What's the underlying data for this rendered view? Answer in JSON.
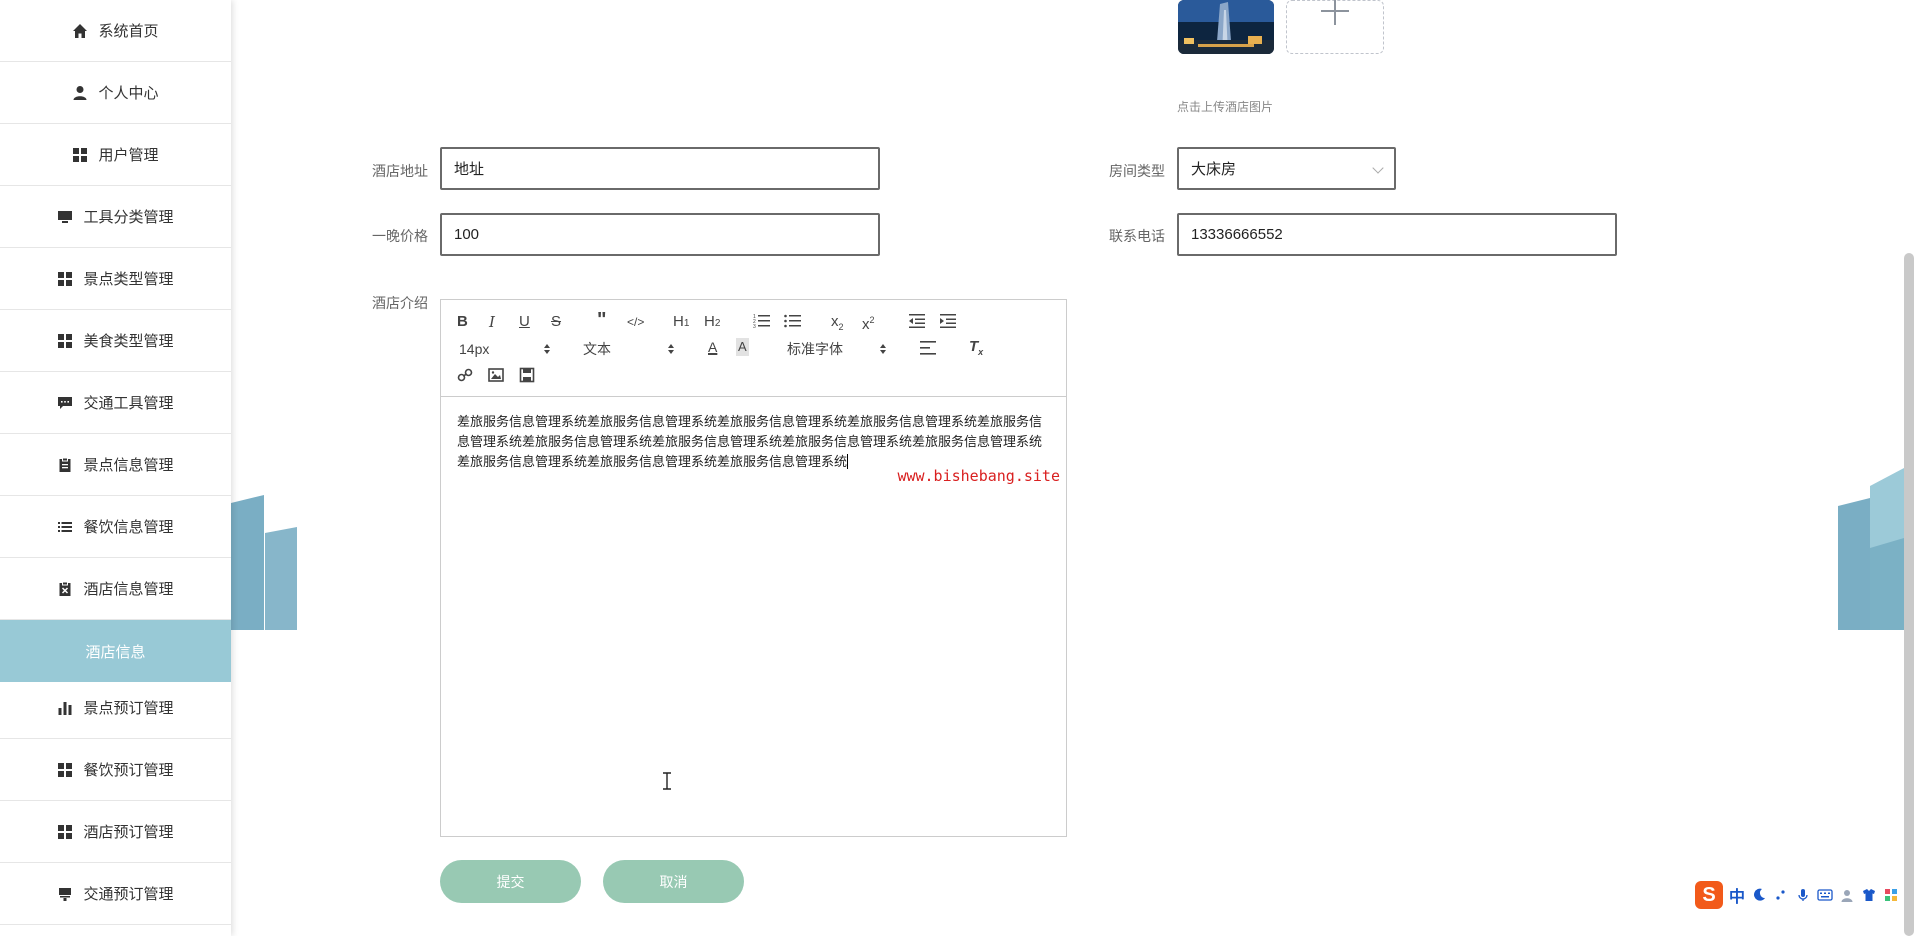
{
  "sidebar": {
    "items": [
      {
        "label": "系统首页",
        "icon": "home-icon"
      },
      {
        "label": "个人中心",
        "icon": "user-icon"
      },
      {
        "label": "用户管理",
        "icon": "grid-icon"
      },
      {
        "label": "工具分类管理",
        "icon": "monitor-icon"
      },
      {
        "label": "景点类型管理",
        "icon": "grid-icon"
      },
      {
        "label": "美食类型管理",
        "icon": "grid-icon"
      },
      {
        "label": "交通工具管理",
        "icon": "chat-icon"
      },
      {
        "label": "景点信息管理",
        "icon": "clipboard-icon"
      },
      {
        "label": "餐饮信息管理",
        "icon": "list-icon"
      },
      {
        "label": "酒店信息管理",
        "icon": "clipboard-x-icon"
      },
      {
        "label": "酒店信息",
        "icon": "",
        "active": true
      },
      {
        "label": "景点预订管理",
        "icon": "bar-chart-icon"
      },
      {
        "label": "餐饮预订管理",
        "icon": "grid-icon"
      },
      {
        "label": "酒店预订管理",
        "icon": "grid-icon"
      },
      {
        "label": "交通预订管理",
        "icon": "stamp-icon"
      }
    ]
  },
  "upload": {
    "tip": "点击上传酒店图片"
  },
  "form": {
    "address_label": "酒店地址",
    "address_value": "地址",
    "room_type_label": "房间类型",
    "room_type_value": "大床房",
    "price_label": "一晚价格",
    "price_value": "100",
    "phone_label": "联系电话",
    "phone_value": "13336666552",
    "intro_label": "酒店介绍"
  },
  "editor": {
    "font_size": "14px",
    "format": "文本",
    "font_family": "标准字体",
    "content": "差旅服务信息管理系统差旅服务信息管理系统差旅服务信息管理系统差旅服务信息管理系统差旅服务信息管理系统差旅服务信息管理系统差旅服务信息管理系统差旅服务信息管理系统差旅服务信息管理系统差旅服务信息管理系统差旅服务信息管理系统差旅服务信息管理系统",
    "watermark": "www.bishebang.site"
  },
  "buttons": {
    "submit": "提交",
    "cancel": "取消"
  },
  "ime": {
    "logo": "S",
    "lang": "中"
  },
  "colors": {
    "active_menu": "#98c9d6",
    "button": "#98c9b3",
    "deco": "#7aaec4",
    "watermark": "#d92020"
  }
}
